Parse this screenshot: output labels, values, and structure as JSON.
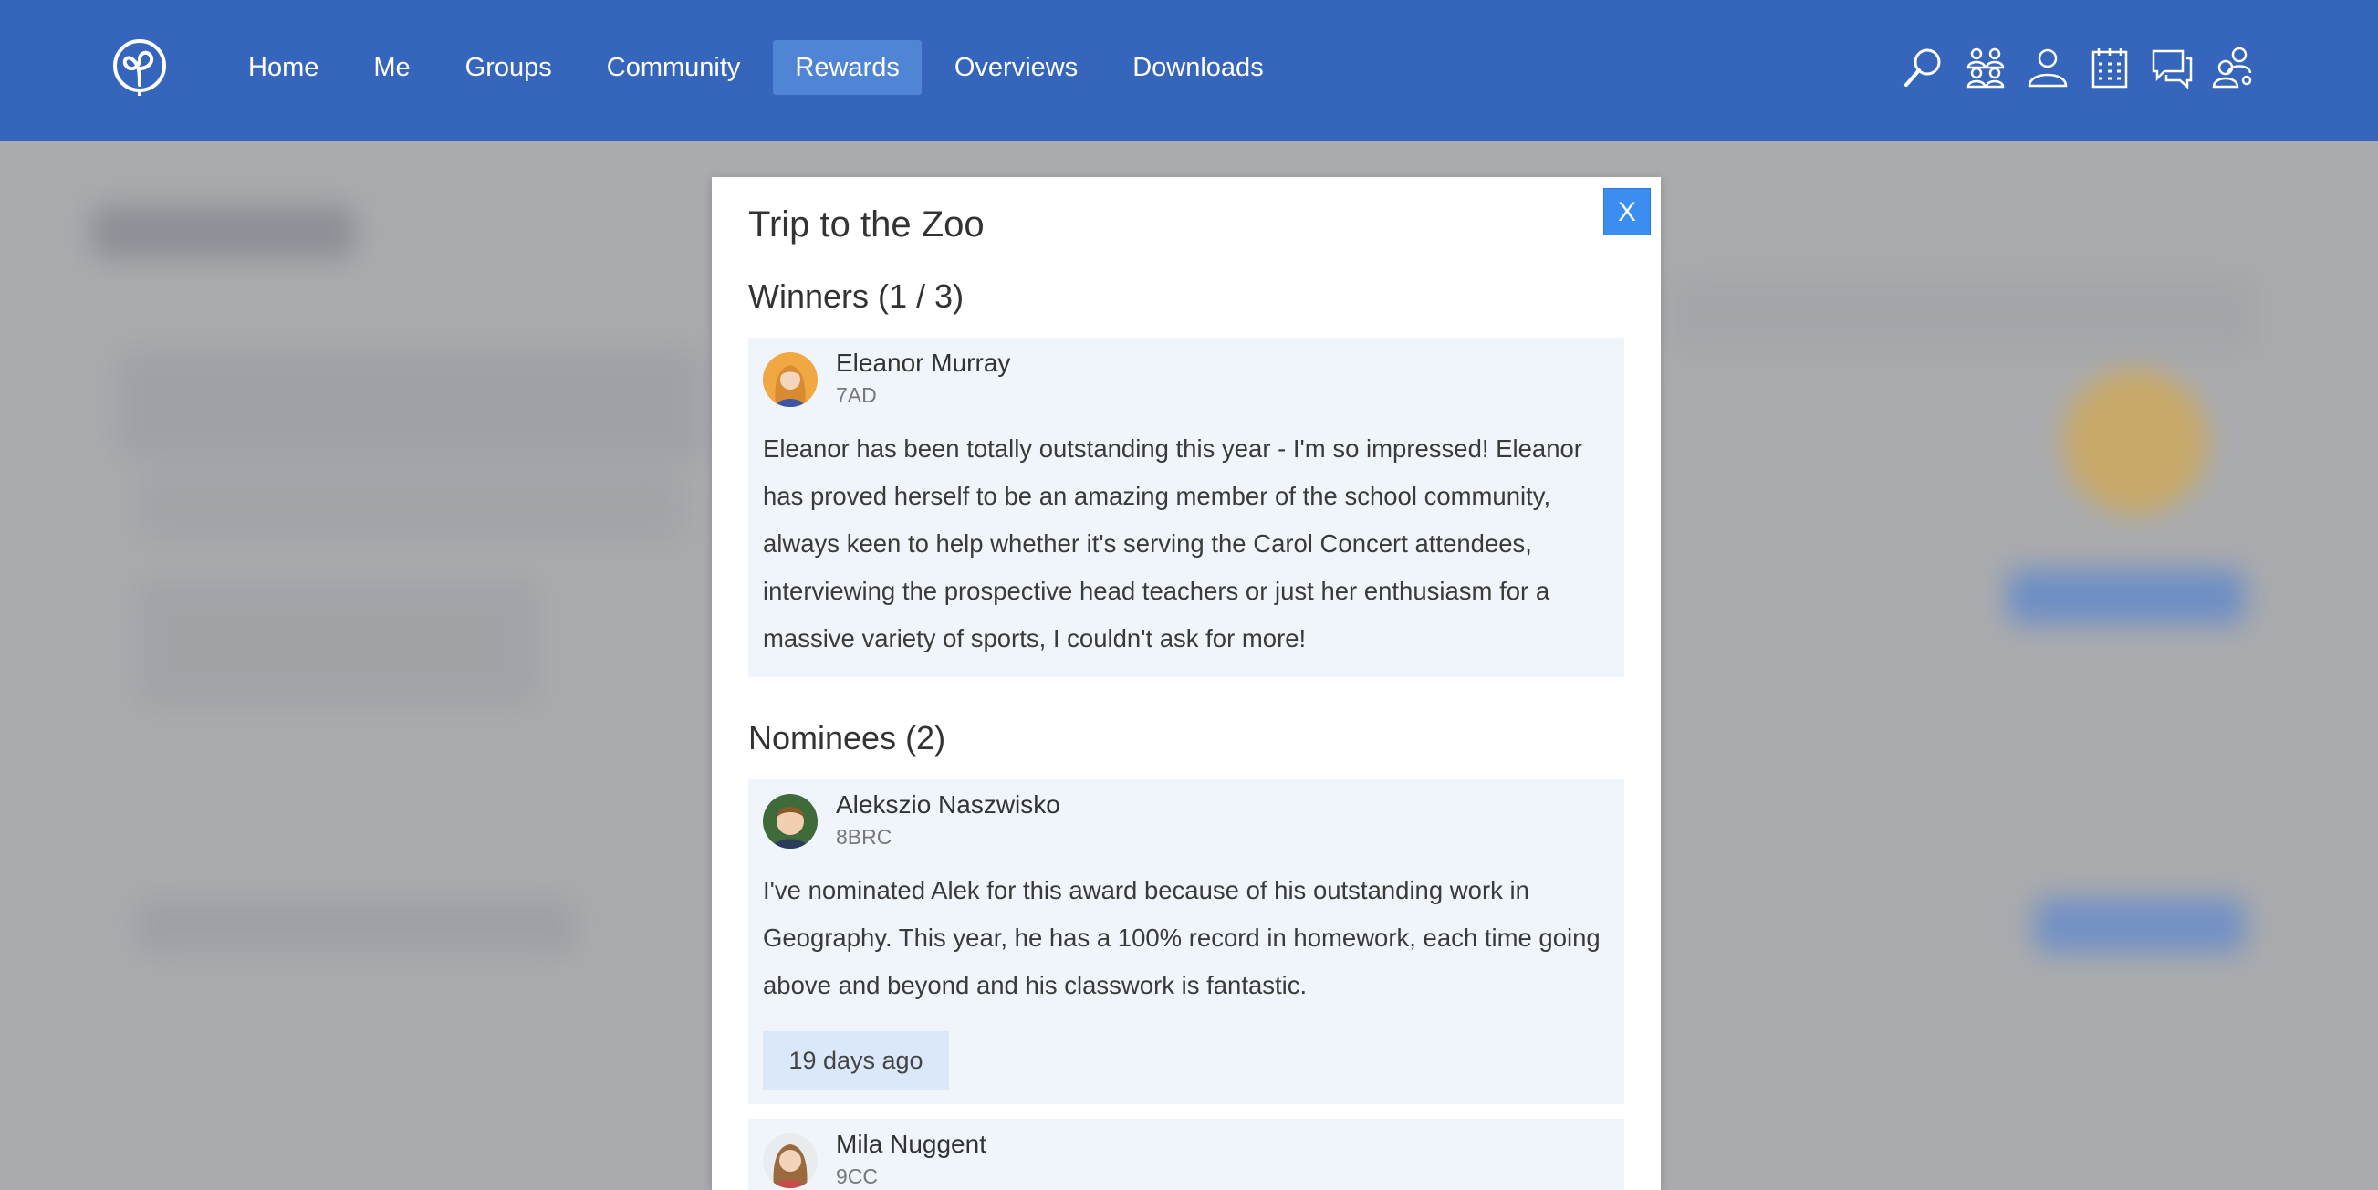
{
  "nav": {
    "items": [
      {
        "label": "Home"
      },
      {
        "label": "Me"
      },
      {
        "label": "Groups"
      },
      {
        "label": "Community"
      },
      {
        "label": "Rewards",
        "active": true
      },
      {
        "label": "Overviews"
      },
      {
        "label": "Downloads"
      }
    ],
    "icons": [
      "search-icon",
      "groups-icon",
      "profile-icon",
      "calendar-icon",
      "messages-icon",
      "users-settings-icon"
    ]
  },
  "colors": {
    "nav_bg": "#3665bc",
    "nav_active": "#4f85d4",
    "close_button": "#3b8df0",
    "card_bg": "#f0f5fc",
    "badge_bg": "#dbe8fa"
  },
  "modal": {
    "title": "Trip to the Zoo",
    "close_label": "X",
    "winners_heading": "Winners (1 / 3)",
    "winners": [
      {
        "name": "Eleanor Murray",
        "class": "7AD",
        "text": "Eleanor has been totally outstanding this year - I'm so impressed! Eleanor has proved herself to be an amazing member of the school community, always keen to help whether it's serving the Carol Concert attendees, interviewing the prospective head teachers or just her enthusiasm for a massive variety of sports, I couldn't ask for more!"
      }
    ],
    "nominees_heading": "Nominees (2)",
    "nominees": [
      {
        "name": "Alekszio Naszwisko",
        "class": "8BRC",
        "text": "I've nominated Alek for this award because of his outstanding work in Geography. This year, he has a 100% record in homework, each time going above and beyond and his classwork is fantastic.",
        "time": "19 days ago"
      },
      {
        "name": "Mila Nuggent",
        "class": "9CC"
      }
    ]
  }
}
